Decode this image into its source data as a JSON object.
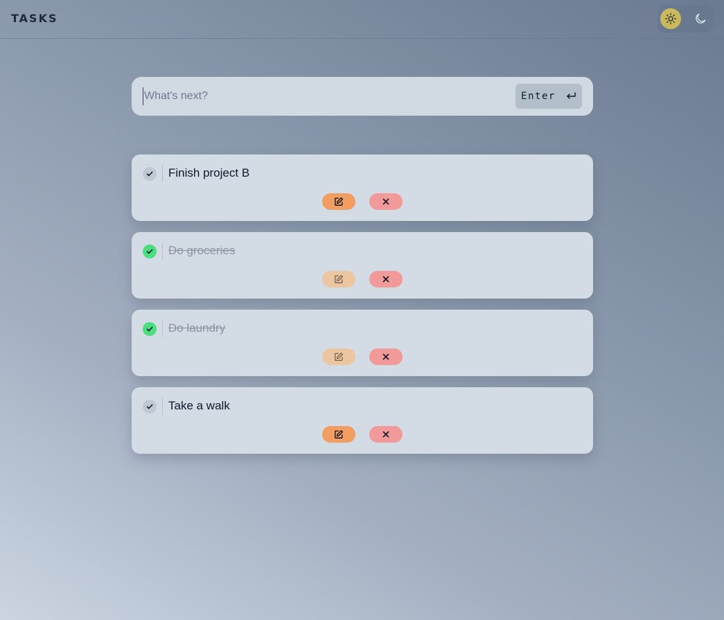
{
  "header": {
    "title": "TASKS",
    "theme_toggle": {
      "light_icon": "sun-icon",
      "dark_icon": "moon-icon",
      "active": "light",
      "active_color": "#c9b95c"
    }
  },
  "input": {
    "placeholder": "What's next?",
    "value": "",
    "enter_label": "Enter",
    "enter_icon": "return-arrow-icon"
  },
  "tasks": [
    {
      "text": "Finish project B",
      "completed": false
    },
    {
      "text": "Do groceries",
      "completed": true
    },
    {
      "text": "Do laundry",
      "completed": true
    },
    {
      "text": "Take a walk",
      "completed": false
    }
  ],
  "task_actions": {
    "edit_icon": "edit-icon",
    "delete_icon": "close-icon"
  },
  "colors": {
    "edit": "#f29d61",
    "edit_disabled": "#ecc6a1",
    "delete": "#f29a9a",
    "done_check": "#4ade80"
  }
}
